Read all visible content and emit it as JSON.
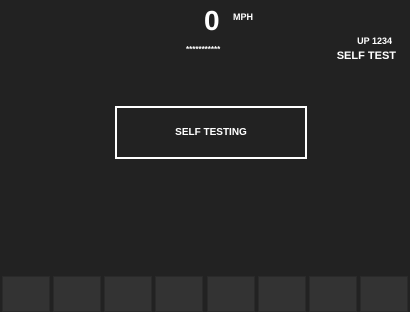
{
  "speed": {
    "value": "0",
    "unit": "MPH"
  },
  "masked_text": "***********",
  "unit_id": "UP 1234",
  "mode_label": "SELF TEST",
  "status_box": {
    "text": "SELF TESTING"
  },
  "softkeys": {
    "count": 8
  },
  "colors": {
    "background": "#222222",
    "text": "#ffffff",
    "softkey": "#333333"
  }
}
